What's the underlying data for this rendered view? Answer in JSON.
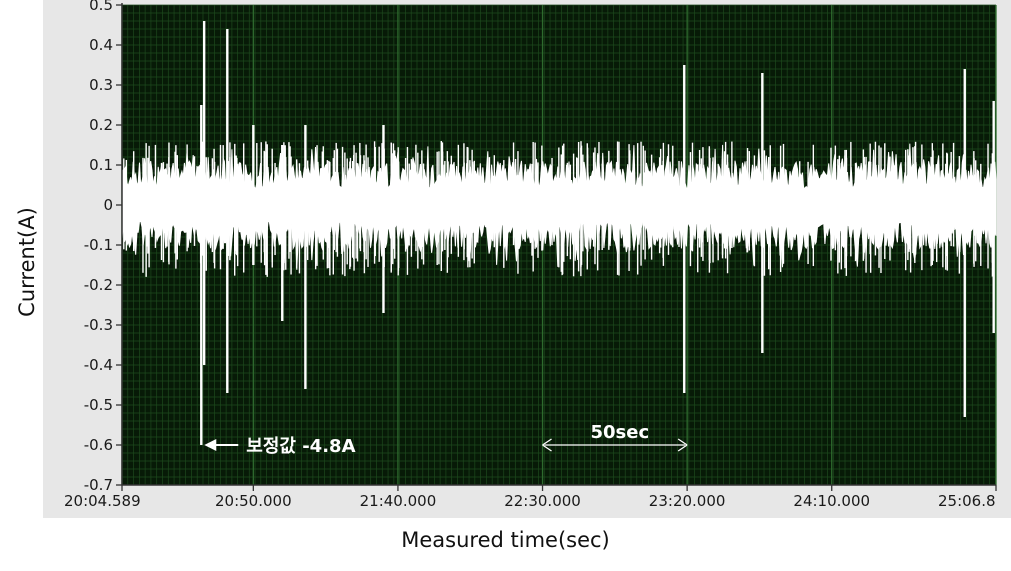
{
  "chart_data": {
    "type": "line",
    "xlabel": "Measured time(sec)",
    "ylabel": "Current(A)",
    "ylim": [
      -0.7,
      0.5
    ],
    "y_ticks": [
      "0.5",
      "0.4",
      "0.3",
      "0.2",
      "0.1",
      "0",
      "-0.1",
      "-0.2",
      "-0.3",
      "-0.4",
      "-0.5",
      "-0.6",
      "-0.7"
    ],
    "xlim": [
      "20:04.589",
      "25:06.8"
    ],
    "x_ticks": [
      "20:04.589",
      "20:50.000",
      "21:40.000",
      "22:30.000",
      "23:20.000",
      "24:10.000",
      "25:06.8"
    ],
    "grid": true,
    "background_color": "#071a07",
    "grid_color": "#1e4a1e",
    "major_grid_color": "#2e6a2e",
    "series_color": "#ffffff",
    "annotations": [
      {
        "text": "보정값 -4.8A",
        "points_to": "spike near 20:31",
        "value": -0.6
      },
      {
        "text": "50sec",
        "span": [
          "22:30.000",
          "23:20.000"
        ],
        "value": -0.6
      }
    ],
    "series": [
      {
        "noise_band": [
          -0.1,
          0.1
        ],
        "spikes": [
          {
            "t": "20:32",
            "max": 0.25,
            "min": -0.6
          },
          {
            "t": "20:33",
            "max": 0.46,
            "min": -0.4
          },
          {
            "t": "20:41",
            "max": 0.44,
            "min": -0.47
          },
          {
            "t": "20:50",
            "max": 0.2,
            "min": -0.15
          },
          {
            "t": "21:00",
            "max": 0.15,
            "min": -0.29
          },
          {
            "t": "21:08",
            "max": 0.2,
            "min": -0.46
          },
          {
            "t": "21:35",
            "max": 0.2,
            "min": -0.27
          },
          {
            "t": "23:19",
            "max": 0.35,
            "min": -0.47
          },
          {
            "t": "23:46",
            "max": 0.33,
            "min": -0.37
          },
          {
            "t": "24:56",
            "max": 0.34,
            "min": -0.53
          },
          {
            "t": "25:06",
            "max": 0.26,
            "min": -0.32
          }
        ]
      }
    ]
  }
}
